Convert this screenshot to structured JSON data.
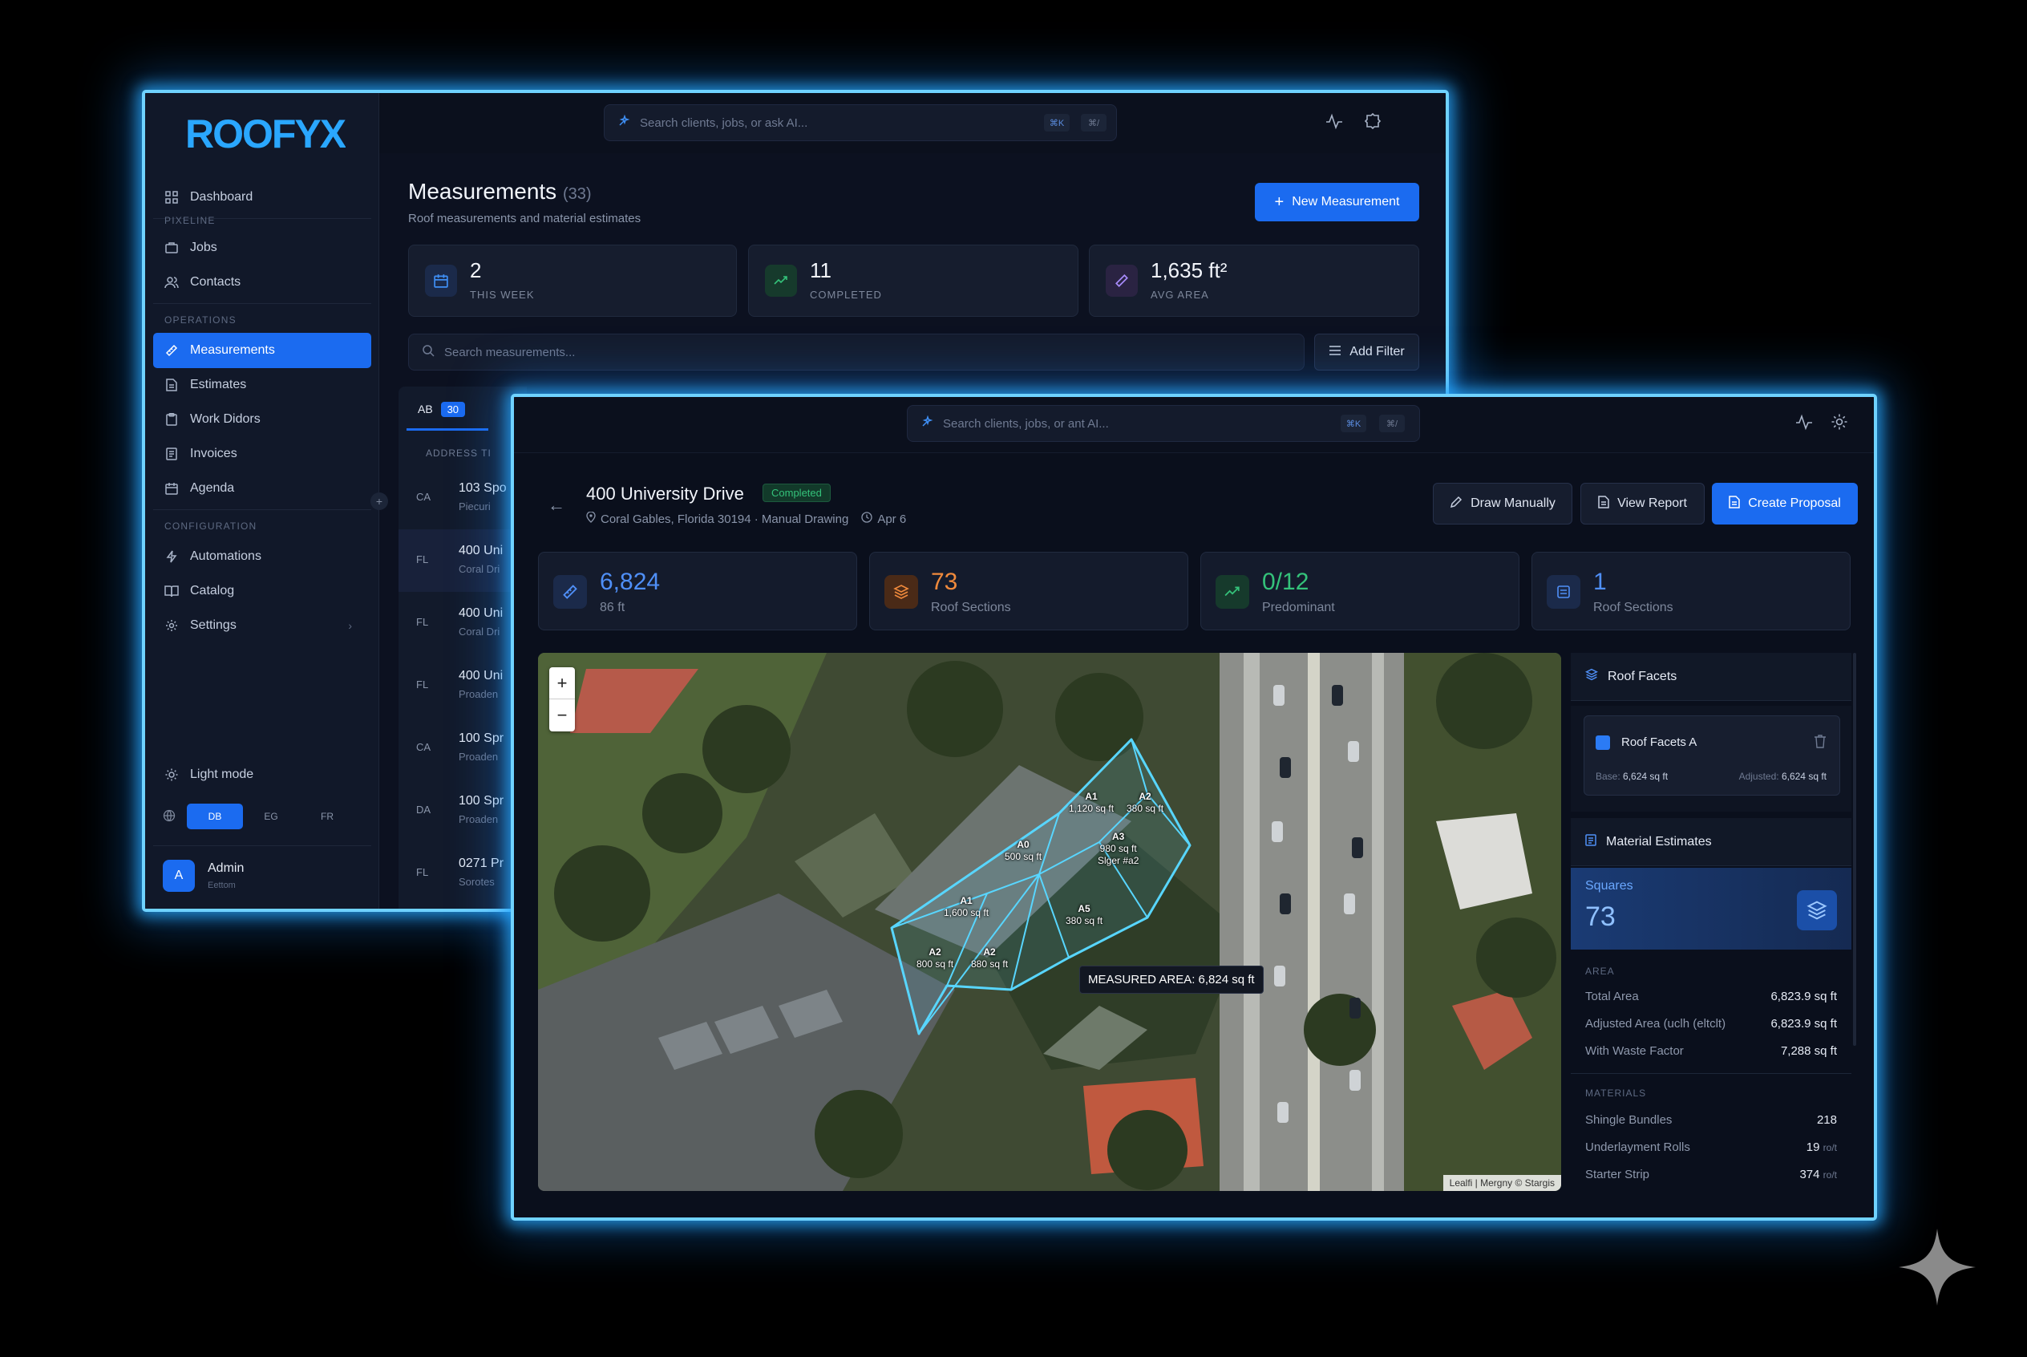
{
  "back_window": {
    "brand": "ROOFYX",
    "search": {
      "placeholder": "Search clients, jobs, or ask AI...",
      "kbd1": "⌘K",
      "kbd2": "⌘/"
    },
    "sidebar": {
      "dashboard": "Dashboard",
      "section_pipeline": "PIXELINE",
      "jobs": "Jobs",
      "contacts": "Contacts",
      "section_operations": "OPERATIONS",
      "measurements": "Measurements",
      "estimates": "Estimates",
      "work_orders": "Work Didors",
      "invoices": "Invoices",
      "agenda": "Agenda",
      "section_configuration": "CONFIGURATION",
      "automations": "Automations",
      "catalog": "Catalog",
      "settings": "Settings",
      "light_mode": "Light mode",
      "lang_options": [
        "DB",
        "EG",
        "FR"
      ],
      "user_initial": "A",
      "user_name": "Admin",
      "user_role": "Eettom"
    },
    "page": {
      "title": "Measurements",
      "count": "(33)",
      "subtitle": "Roof measurements and material estimates",
      "new_button": "New Measurement",
      "stats": [
        {
          "value": "2",
          "label": "THIS WEEK"
        },
        {
          "value": "11",
          "label": "COMPLETED"
        },
        {
          "value": "1,635 ft²",
          "label": "AVG AREA"
        }
      ],
      "search_placeholder": "Search measurements...",
      "add_filter": "Add Filter",
      "tab_label": "AB",
      "tab_count": "30",
      "column_header": "ADDRESS TI",
      "rows": [
        {
          "state": "CA",
          "title": "103 Spo",
          "sub": "Piecuri"
        },
        {
          "state": "FL",
          "title": "400 Uni",
          "sub": "Coral Dri"
        },
        {
          "state": "FL",
          "title": "400 Uni",
          "sub": "Coral Dri"
        },
        {
          "state": "FL",
          "title": "400 Uni",
          "sub": "Proaden"
        },
        {
          "state": "CA",
          "title": "100 Spr",
          "sub": "Proaden"
        },
        {
          "state": "DA",
          "title": "100 Spr",
          "sub": "Proaden"
        },
        {
          "state": "FL",
          "title": "0271 Pr",
          "sub": "Sorotes"
        }
      ]
    }
  },
  "front_window": {
    "search": {
      "placeholder": "Search clients, jobs, or ant AI...",
      "kbd1": "⌘K",
      "kbd2": "⌘/"
    },
    "header": {
      "title": "400 University Drive",
      "status": "Completed",
      "location": "Coral Gables, Florida 30194 · Manual Drawing",
      "date": "Apr 6",
      "draw_manually": "Draw Manually",
      "view_report": "View Report",
      "create_proposal": "Create Proposal"
    },
    "stats": [
      {
        "value": "6,824",
        "label": "86 ft",
        "color": "#4f8ff7"
      },
      {
        "value": "73",
        "label": "Roof Sections",
        "color": "#f08a3c"
      },
      {
        "value": "0/12",
        "label": "Predominant",
        "color": "#34c27a"
      },
      {
        "value": "1",
        "label": "Roof Sections",
        "color": "#4f8ff7"
      }
    ],
    "map": {
      "zoom_in": "+",
      "zoom_out": "−",
      "measured_area": "MEASURED AREA: 6,824 sq ft",
      "attribution": "Lealfi | Mergny © Stargis",
      "facets": [
        {
          "name": "A1",
          "area": "1,120 sq ft"
        },
        {
          "name": "A2",
          "area": "380 sq ft"
        },
        {
          "name": "A0",
          "area": "500 sq ft"
        },
        {
          "name": "A3",
          "area": "980 sq ft",
          "extra": "Slger #a2"
        },
        {
          "name": "A1",
          "area": "1,600 sq ft"
        },
        {
          "name": "A5",
          "area": "380 sq ft"
        },
        {
          "name": "A2",
          "area": "800 sq ft"
        },
        {
          "name": "A2",
          "area": "880 sq ft"
        }
      ]
    },
    "right_panel": {
      "roof_facets_title": "Roof Facets",
      "facet_name": "Roof Facets A",
      "facet_color": "#2b7bf5",
      "base_label": "Base:",
      "base_value": "6,624 sq ft",
      "adjusted_label": "Adjusted:",
      "adjusted_value": "6,624 sq ft",
      "material_title": "Material Estimates",
      "squares_label": "Squares",
      "squares_value": "73",
      "area_section": "AREA",
      "area_rows": [
        {
          "label": "Total Area",
          "value": "6,823.9 sq ft"
        },
        {
          "label": "Adjusted Area (uclh (eltclt)",
          "value": "6,823.9 sq ft"
        },
        {
          "label": "With Waste Factor",
          "value": "7,288 sq ft"
        }
      ],
      "materials_section": "MATERIALS",
      "material_rows": [
        {
          "label": "Shingle Bundles",
          "value": "218",
          "unit": ""
        },
        {
          "label": "Underlayment Rolls",
          "value": "19",
          "unit": "ro/t"
        },
        {
          "label": "Starter Strip",
          "value": "374",
          "unit": "ro/t"
        }
      ]
    }
  }
}
